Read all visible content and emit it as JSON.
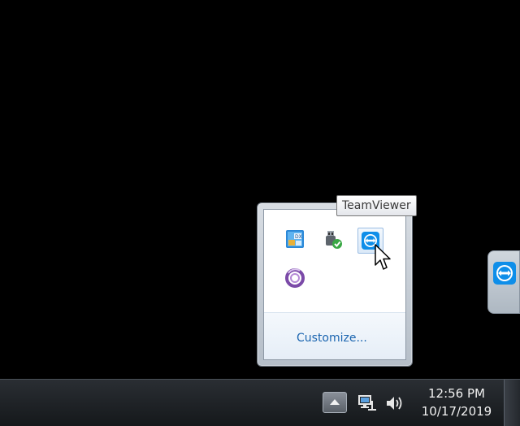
{
  "tooltip": {
    "text": "TeamViewer"
  },
  "flyout": {
    "customize_label": "Customize...",
    "icons": [
      {
        "name": "remote-desktop-tray-icon",
        "hovered": false
      },
      {
        "name": "safely-remove-hardware-tray-icon",
        "hovered": false
      },
      {
        "name": "teamviewer-tray-icon",
        "hovered": true
      },
      {
        "name": "purple-ring-app-tray-icon",
        "hovered": false
      }
    ]
  },
  "taskbar": {
    "time": "12:56 PM",
    "date": "10/17/2019",
    "icons": [
      "show-hidden-icons-arrow",
      "network-icon",
      "volume-icon"
    ]
  },
  "colors": {
    "desktop": "#000000",
    "link": "#1b65b0",
    "teamviewer_blue": "#0e8ee9"
  }
}
